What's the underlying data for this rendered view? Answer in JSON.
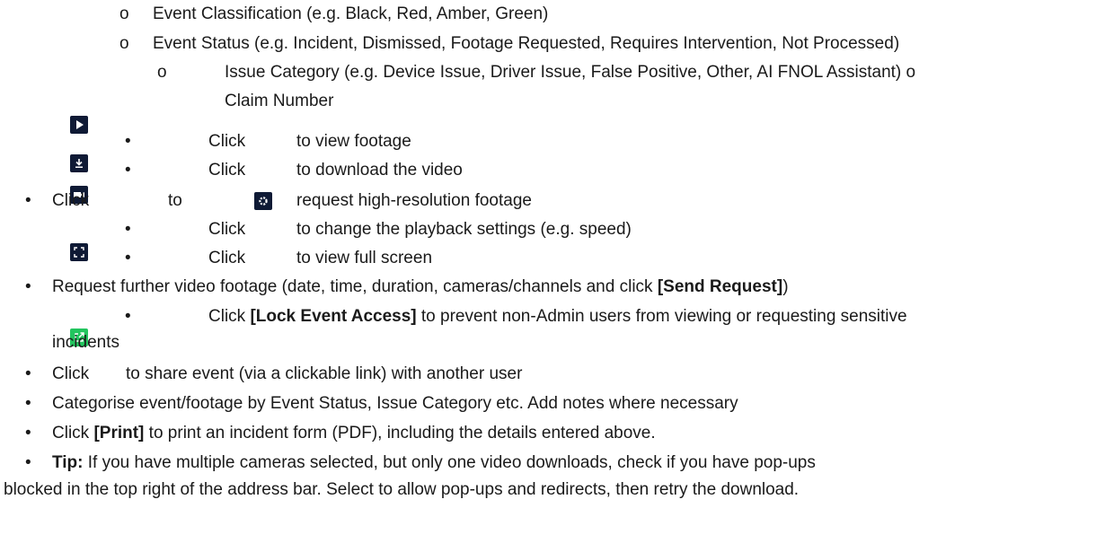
{
  "bullets": {
    "circle": "o",
    "dot": "•"
  },
  "lines": {
    "event_classification": "Event Classification (e.g. Black, Red, Amber, Green)",
    "event_status": "Event Status (e.g. Incident, Dismissed, Footage Requested, Requires Intervention, Not Processed)",
    "issue_category": "Issue Category (e.g. Device Issue, Driver Issue, False Positive, Other, AI FNOL Assistant) o",
    "claim_number": "Claim Number",
    "view_footage_click": "Click",
    "view_footage_text": "to view footage",
    "download_click": "Click",
    "download_text": "to download the video",
    "request_click": "Click",
    "request_to": "to",
    "request_text": "request high-resolution footage",
    "settings_click": "Click",
    "settings_text": "to change the playback settings (e.g. speed)",
    "fullscreen_click": "Click",
    "fullscreen_text": "to view full screen",
    "further_pre": "Request further video footage (date, time, duration, cameras/channels and click ",
    "further_bold": "[Send Request]",
    "further_post": ")",
    "lock_click": "Click ",
    "lock_bold": "[Lock Event Access]",
    "lock_post": " to prevent non-Admin users from viewing or requesting sensitive",
    "lock_cont": "incidents",
    "share_click": "Click",
    "share_text": "to share event (via a clickable link) with another user",
    "categorise": "Categorise event/footage by Event Status, Issue Category etc. Add notes where necessary",
    "print_click": "Click ",
    "print_bold": "[Print]",
    "print_post": " to print an incident form (PDF), including the details entered above.",
    "tip_bold": "Tip:",
    "tip_text": " If you have multiple cameras selected, but only one video downloads, check if you have pop-ups",
    "tip_cont": "blocked in the top right of the address bar. Select to allow pop-ups and redirects, then retry the download."
  },
  "icons": [
    "play-icon",
    "download-icon",
    "video-camera-icon",
    "gear-icon",
    "fullscreen-icon",
    "share-icon"
  ],
  "colors": {
    "icon_dark": "#0f1a35",
    "icon_green": "#22c55e",
    "text": "#1a1a1a"
  }
}
